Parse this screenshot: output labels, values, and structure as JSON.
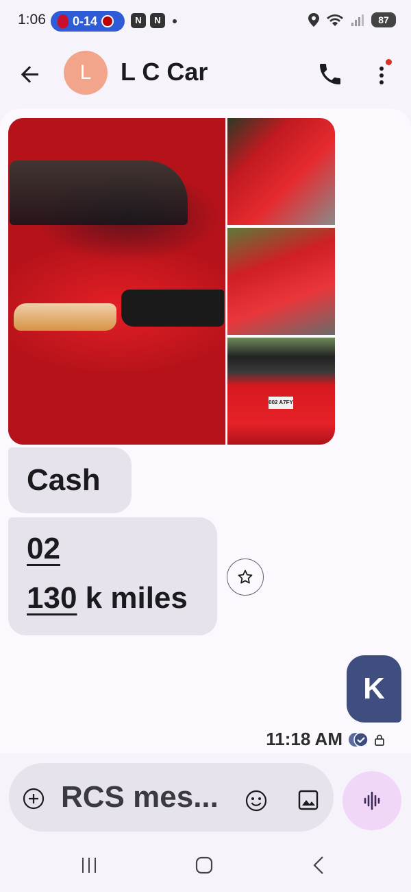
{
  "status_bar": {
    "time": "1:06",
    "score": "0-14",
    "battery": "87",
    "notification_badge": "N"
  },
  "header": {
    "avatar_letter": "L",
    "contact_name": "L C Car"
  },
  "conversation": {
    "photos": [
      "photo-main",
      "photo-side-1",
      "photo-side-2",
      "photo-side-3"
    ],
    "plate_text": "002 A7FY",
    "received": {
      "cash": "Cash",
      "year": "02",
      "mileage_number": "130",
      "mileage_suffix": " k miles"
    },
    "sent": {
      "letter": "K",
      "time": "11:18 AM"
    }
  },
  "composer": {
    "placeholder": "RCS mes..."
  },
  "colors": {
    "accent_sent": "#3f4e7e",
    "avatar": "#f2a58b",
    "voice_button": "#f0d6f7"
  }
}
